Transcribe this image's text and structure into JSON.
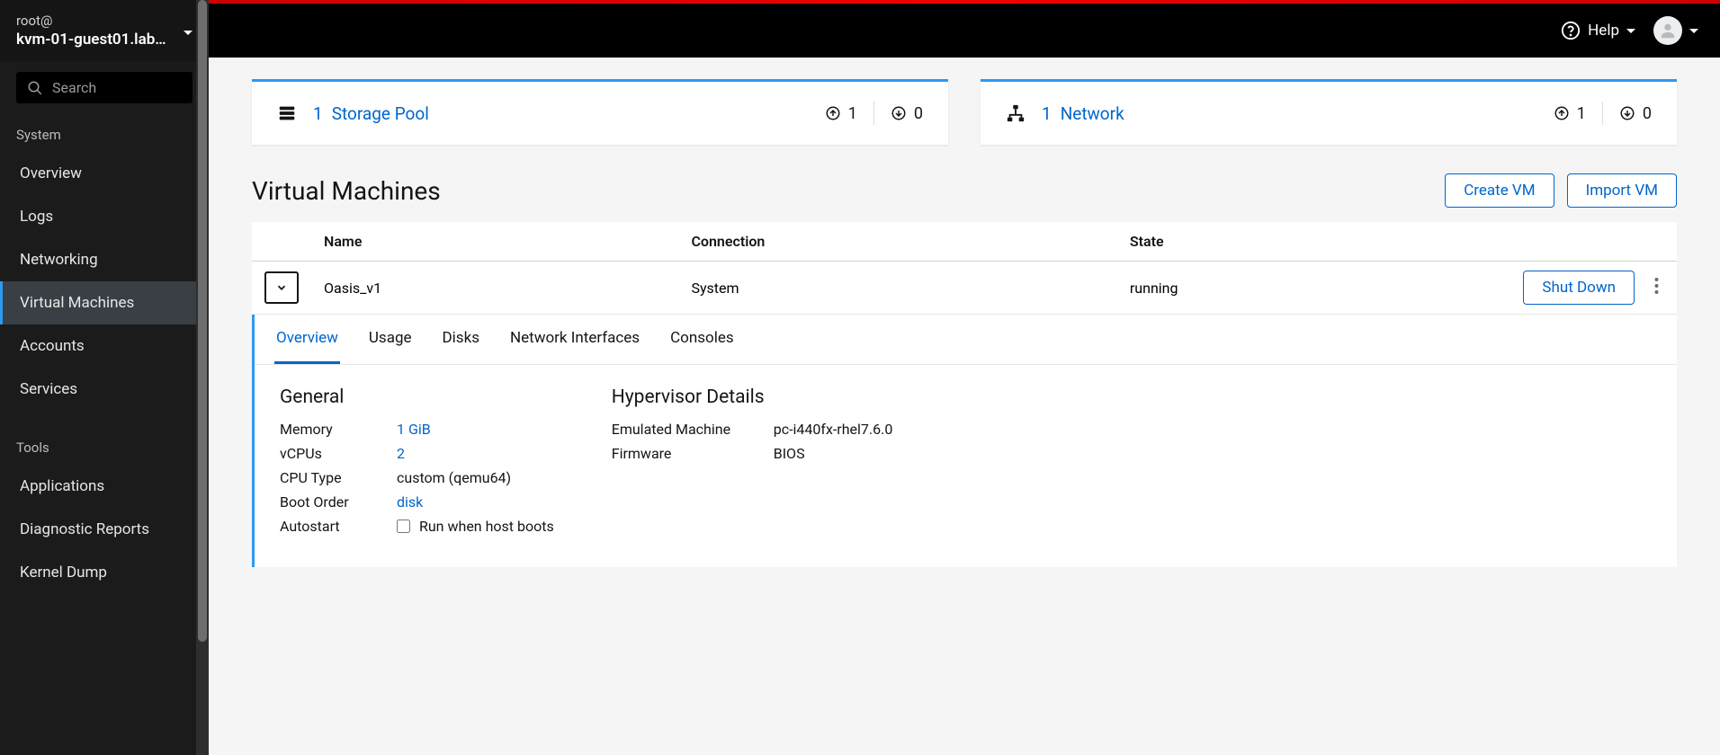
{
  "header": {
    "help_label": "Help"
  },
  "host_picker": {
    "user": "root@",
    "host": "kvm-01-guest01.lab.e..."
  },
  "search": {
    "placeholder": "Search"
  },
  "nav": {
    "system_label": "System",
    "system_items": [
      {
        "label": "Overview"
      },
      {
        "label": "Logs"
      },
      {
        "label": "Networking"
      },
      {
        "label": "Virtual Machines",
        "active": true
      },
      {
        "label": "Accounts"
      },
      {
        "label": "Services"
      }
    ],
    "tools_label": "Tools",
    "tools_items": [
      {
        "label": "Applications"
      },
      {
        "label": "Diagnostic Reports"
      },
      {
        "label": "Kernel Dump"
      }
    ]
  },
  "cards": {
    "storage": {
      "count": "1",
      "label": "Storage Pool",
      "up": "1",
      "down": "0"
    },
    "network": {
      "count": "1",
      "label": "Network",
      "up": "1",
      "down": "0"
    }
  },
  "vm_section": {
    "title": "Virtual Machines",
    "create_btn": "Create VM",
    "import_btn": "Import VM",
    "columns": {
      "name": "Name",
      "connection": "Connection",
      "state": "State"
    },
    "row": {
      "name": "Oasis_v1",
      "connection": "System",
      "state": "running",
      "shutdown_btn": "Shut Down"
    }
  },
  "tabs": {
    "overview": "Overview",
    "usage": "Usage",
    "disks": "Disks",
    "nics": "Network Interfaces",
    "consoles": "Consoles"
  },
  "details": {
    "general": {
      "heading": "General",
      "memory_k": "Memory",
      "memory_v": "1 GiB",
      "vcpus_k": "vCPUs",
      "vcpus_v": "2",
      "cputype_k": "CPU Type",
      "cputype_v": "custom (qemu64)",
      "bootorder_k": "Boot Order",
      "bootorder_v": "disk",
      "autostart_k": "Autostart",
      "autostart_label": "Run when host boots"
    },
    "hypervisor": {
      "heading": "Hypervisor Details",
      "emulated_k": "Emulated Machine",
      "emulated_v": "pc-i440fx-rhel7.6.0",
      "firmware_k": "Firmware",
      "firmware_v": "BIOS"
    }
  }
}
